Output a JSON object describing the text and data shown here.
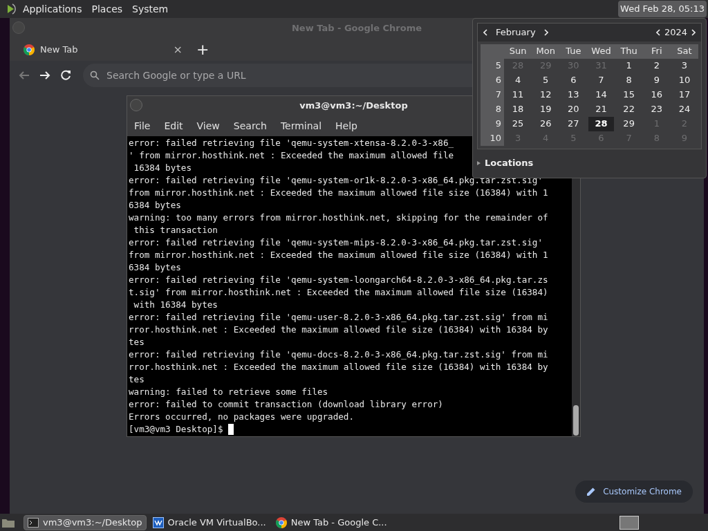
{
  "top_panel": {
    "menus": [
      "Applications",
      "Places",
      "System"
    ],
    "clock": "Wed Feb 28, 05:13"
  },
  "chrome": {
    "title": "New Tab - Google Chrome",
    "tab": {
      "label": "New Tab",
      "close": "×",
      "new": "+"
    },
    "search_placeholder": "Search Google or type a URL",
    "customize": "Customize Chrome"
  },
  "terminal": {
    "title": "vm3@vm3:~/Desktop",
    "menus": [
      "File",
      "Edit",
      "View",
      "Search",
      "Terminal",
      "Help"
    ],
    "lines": [
      "error: failed retrieving file 'qemu-system-xtensa-8.2.0-3-x86_",
      "' from mirror.hosthink.net : Exceeded the maximum allowed file",
      " 16384 bytes",
      "error: failed retrieving file 'qemu-system-or1k-8.2.0-3-x86_64.pkg.tar.zst.sig'",
      "from mirror.hosthink.net : Exceeded the maximum allowed file size (16384) with 1",
      "6384 bytes",
      "warning: too many errors from mirror.hosthink.net, skipping for the remainder of",
      " this transaction",
      "error: failed retrieving file 'qemu-system-mips-8.2.0-3-x86_64.pkg.tar.zst.sig'",
      "from mirror.hosthink.net : Exceeded the maximum allowed file size (16384) with 1",
      "6384 bytes",
      "error: failed retrieving file 'qemu-system-loongarch64-8.2.0-3-x86_64.pkg.tar.zs",
      "t.sig' from mirror.hosthink.net : Exceeded the maximum allowed file size (16384)",
      " with 16384 bytes",
      "error: failed retrieving file 'qemu-user-8.2.0-3-x86_64.pkg.tar.zst.sig' from mi",
      "rror.hosthink.net : Exceeded the maximum allowed file size (16384) with 16384 by",
      "tes",
      "error: failed retrieving file 'qemu-docs-8.2.0-3-x86_64.pkg.tar.zst.sig' from mi",
      "rror.hosthink.net : Exceeded the maximum allowed file size (16384) with 16384 by",
      "tes",
      "warning: failed to retrieve some files",
      "error: failed to commit transaction (download library error)",
      "Errors occurred, no packages were upgraded."
    ],
    "prompt": "[vm3@vm3 Desktop]$"
  },
  "calendar": {
    "month": "February",
    "year": "2024",
    "weekdays": [
      "Sun",
      "Mon",
      "Tue",
      "Wed",
      "Thu",
      "Fri",
      "Sat"
    ],
    "weeks": [
      {
        "week": "5",
        "days": [
          {
            "label": "28",
            "dim": true,
            "selected": false
          },
          {
            "label": "29",
            "dim": true,
            "selected": false
          },
          {
            "label": "30",
            "dim": true,
            "selected": false
          },
          {
            "label": "31",
            "dim": true,
            "selected": false
          },
          {
            "label": "1",
            "dim": false,
            "selected": false
          },
          {
            "label": "2",
            "dim": false,
            "selected": false
          },
          {
            "label": "3",
            "dim": false,
            "selected": false
          }
        ]
      },
      {
        "week": "6",
        "days": [
          {
            "label": "4",
            "dim": false,
            "selected": false
          },
          {
            "label": "5",
            "dim": false,
            "selected": false
          },
          {
            "label": "6",
            "dim": false,
            "selected": false
          },
          {
            "label": "7",
            "dim": false,
            "selected": false
          },
          {
            "label": "8",
            "dim": false,
            "selected": false
          },
          {
            "label": "9",
            "dim": false,
            "selected": false
          },
          {
            "label": "10",
            "dim": false,
            "selected": false
          }
        ]
      },
      {
        "week": "7",
        "days": [
          {
            "label": "11",
            "dim": false,
            "selected": false
          },
          {
            "label": "12",
            "dim": false,
            "selected": false
          },
          {
            "label": "13",
            "dim": false,
            "selected": false
          },
          {
            "label": "14",
            "dim": false,
            "selected": false
          },
          {
            "label": "15",
            "dim": false,
            "selected": false
          },
          {
            "label": "16",
            "dim": false,
            "selected": false
          },
          {
            "label": "17",
            "dim": false,
            "selected": false
          }
        ]
      },
      {
        "week": "8",
        "days": [
          {
            "label": "18",
            "dim": false,
            "selected": false
          },
          {
            "label": "19",
            "dim": false,
            "selected": false
          },
          {
            "label": "20",
            "dim": false,
            "selected": false
          },
          {
            "label": "21",
            "dim": false,
            "selected": false
          },
          {
            "label": "22",
            "dim": false,
            "selected": false
          },
          {
            "label": "23",
            "dim": false,
            "selected": false
          },
          {
            "label": "24",
            "dim": false,
            "selected": false
          }
        ]
      },
      {
        "week": "9",
        "days": [
          {
            "label": "25",
            "dim": false,
            "selected": false
          },
          {
            "label": "26",
            "dim": false,
            "selected": false
          },
          {
            "label": "27",
            "dim": false,
            "selected": false
          },
          {
            "label": "28",
            "dim": false,
            "selected": true
          },
          {
            "label": "29",
            "dim": false,
            "selected": false
          },
          {
            "label": "1",
            "dim": true,
            "selected": false
          },
          {
            "label": "2",
            "dim": true,
            "selected": false
          }
        ]
      },
      {
        "week": "10",
        "days": [
          {
            "label": "3",
            "dim": true,
            "selected": false
          },
          {
            "label": "4",
            "dim": true,
            "selected": false
          },
          {
            "label": "5",
            "dim": true,
            "selected": false
          },
          {
            "label": "6",
            "dim": true,
            "selected": false
          },
          {
            "label": "7",
            "dim": true,
            "selected": false
          },
          {
            "label": "8",
            "dim": true,
            "selected": false
          },
          {
            "label": "9",
            "dim": true,
            "selected": false
          }
        ]
      }
    ],
    "locations": "Locations",
    "locations_expanded": false
  },
  "taskbar": [
    {
      "kind": "terminal",
      "label": "vm3@vm3:~/Desktop",
      "selected": true
    },
    {
      "kind": "virtualbox",
      "label": "Oracle VM VirtualBo...",
      "selected": false
    },
    {
      "kind": "chrome",
      "label": "New Tab - Google C...",
      "selected": false
    }
  ]
}
